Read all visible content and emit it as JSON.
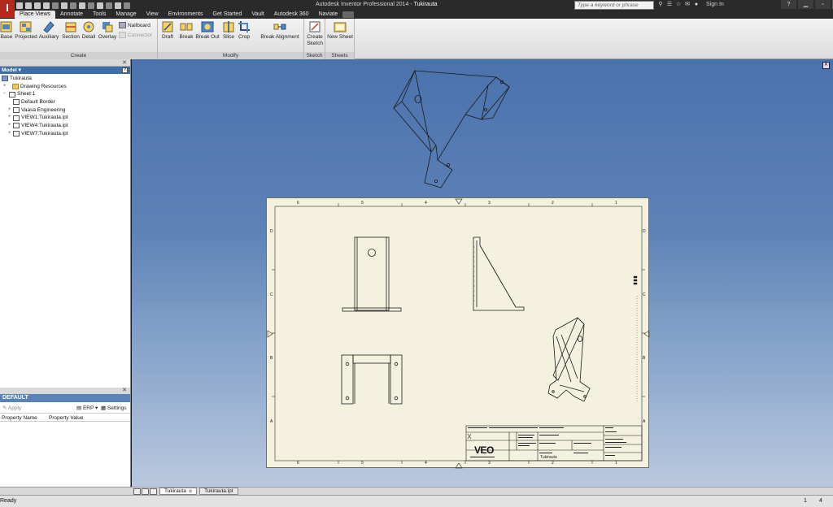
{
  "app": {
    "logo_letter": "I",
    "title_prefix": "Autodesk Inventor Professional 2014",
    "title_doc": "Tukirauta",
    "search_placeholder": "Type a keyword or phrase",
    "sign_in": "Sign In",
    "help_label": "?"
  },
  "tabs": [
    {
      "label": "Place Views",
      "active": true
    },
    {
      "label": "Annotate"
    },
    {
      "label": "Tools"
    },
    {
      "label": "Manage"
    },
    {
      "label": "View"
    },
    {
      "label": "Environments"
    },
    {
      "label": "Get Started"
    },
    {
      "label": "Vault"
    },
    {
      "label": "Autodesk 360"
    },
    {
      "label": "Naviate"
    }
  ],
  "ribbon": {
    "create": {
      "title": "Create",
      "base": "Base",
      "projected": "Projected",
      "auxiliary": "Auxiliary",
      "section": "Section",
      "detail": "Detail",
      "overlay": "Overlay",
      "nailboard": "Nailboard",
      "connector": "Connector"
    },
    "modify": {
      "title": "Modify",
      "draft": "Draft",
      "break": "Break",
      "break_out": "Break Out",
      "slice": "Slice",
      "crop": "Crop",
      "break_alignment": "Break Alignment"
    },
    "sketch": {
      "title": "Sketch",
      "create_sketch_1": "Create",
      "create_sketch_2": "Sketch"
    },
    "sheets": {
      "title": "Sheets",
      "new_sheet": "New Sheet"
    }
  },
  "browser": {
    "header": "Model ▾",
    "tree": [
      {
        "label": "Tukirauta",
        "level": 0,
        "exp": ""
      },
      {
        "label": "Drawing Resources",
        "level": 1,
        "exp": "+"
      },
      {
        "label": "Sheet:1",
        "level": 1,
        "exp": "−"
      },
      {
        "label": "Default Border",
        "level": 2,
        "exp": ""
      },
      {
        "label": "Vaasa Engineering",
        "level": 2,
        "exp": "+"
      },
      {
        "label": "VIEW1:Tukirauta.ipt",
        "level": 2,
        "exp": "+"
      },
      {
        "label": "VIEW4:Tukirauta.ipt",
        "level": 2,
        "exp": "+"
      },
      {
        "label": "VIEW7:Tukirauta.ipt",
        "level": 2,
        "exp": "+"
      }
    ]
  },
  "properties": {
    "title": "DEFAULT",
    "apply": "Apply",
    "erp": "ERP ▾",
    "settings": "Settings",
    "col_name": "Property Name",
    "col_value": "Property Value"
  },
  "sheet": {
    "col_labels_top": [
      "6",
      "5",
      "4",
      "3",
      "2",
      "1"
    ],
    "col_labels_bottom": [
      "6",
      "5",
      "4",
      "3",
      "2",
      "1"
    ],
    "row_labels": [
      "D",
      "C",
      "B",
      "A"
    ],
    "logo": "VEO",
    "part_name": "Tukirauta"
  },
  "document_tabs": [
    {
      "label": "Tukirauta",
      "active": true
    },
    {
      "label": "Tukirauta.ipt",
      "active": false
    }
  ],
  "status": {
    "text": "Ready",
    "n1": "1",
    "n2": "4"
  }
}
